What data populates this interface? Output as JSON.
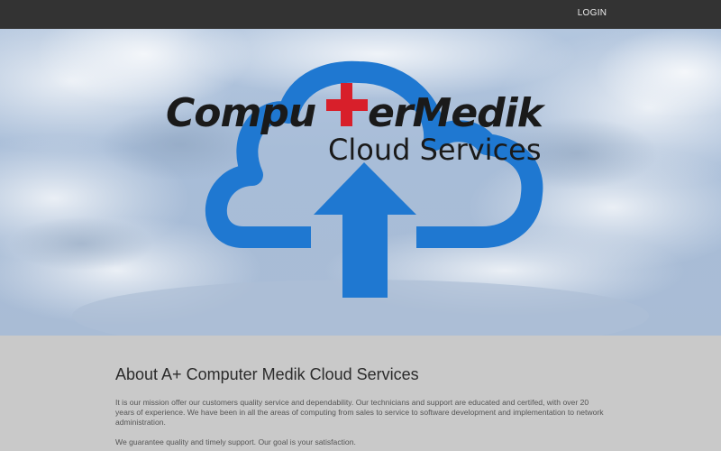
{
  "nav": {
    "login_label": "LOGIN"
  },
  "logo": {
    "brand_left": "Compu",
    "brand_right": "erMedik",
    "subtitle": "Cloud Services"
  },
  "about": {
    "title": "About A+ Computer Medik Cloud Services",
    "paragraph1": "It is our mission offer our customers quality service and dependability. Our technicians and support are educated and certifed, with over 20 years of experience. We have been in all the areas of computing from sales to service to software development and implementation to network administration.",
    "paragraph2": "We guarantee quality and timely support. Our goal is your satisfaction."
  },
  "colors": {
    "topbar": "#333333",
    "cloud_blue": "#1f78d1",
    "cross_red": "#d81f2a",
    "footer_gray": "#c9c9c9"
  },
  "icons": [
    "cloud-upload-icon",
    "medical-cross-icon"
  ]
}
